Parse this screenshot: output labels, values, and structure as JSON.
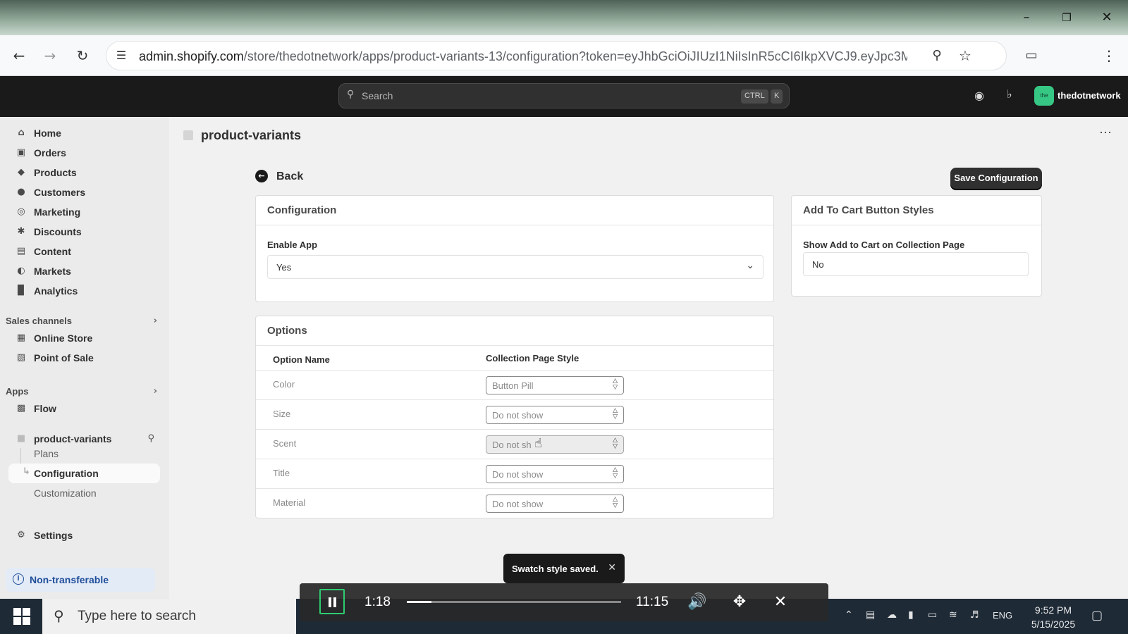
{
  "browser": {
    "url_host": "admin.shopify.com",
    "url_rest": "/store/thedotnetwork/apps/product-variants-13/configuration?token=eyJhbGciOiJIUzI1NiIsInR5cCI6IkpXVCJ9.eyJpc3MiOiJodH..."
  },
  "header": {
    "search_placeholder": "Search",
    "shortcut_key1": "CTRL",
    "shortcut_key2": "K",
    "store_badge": "the",
    "store_name": "thedotnetwork"
  },
  "sidebar": {
    "items": [
      {
        "label": "Home",
        "icon": "home-icon"
      },
      {
        "label": "Orders",
        "icon": "orders-icon"
      },
      {
        "label": "Products",
        "icon": "tag-icon"
      },
      {
        "label": "Customers",
        "icon": "person-icon"
      },
      {
        "label": "Marketing",
        "icon": "target-icon"
      },
      {
        "label": "Discounts",
        "icon": "discount-icon"
      },
      {
        "label": "Content",
        "icon": "content-icon"
      },
      {
        "label": "Markets",
        "icon": "globe-icon"
      },
      {
        "label": "Analytics",
        "icon": "chart-icon"
      }
    ],
    "sales_channels_label": "Sales channels",
    "channels": [
      {
        "label": "Online Store",
        "icon": "store-icon"
      },
      {
        "label": "Point of Sale",
        "icon": "pos-icon"
      }
    ],
    "apps_label": "Apps",
    "apps": [
      {
        "label": "Flow",
        "icon": "flow-icon"
      }
    ],
    "app_name": "product-variants",
    "app_subitems": [
      "Plans",
      "Configuration",
      "Customization"
    ],
    "settings_label": "Settings",
    "non_transferable": "Non-transferable"
  },
  "page": {
    "title": "product-variants",
    "back_label": "Back",
    "save_label": "Save Configuration"
  },
  "configuration": {
    "title": "Configuration",
    "enable_label": "Enable App",
    "enable_value": "Yes"
  },
  "add_to_cart": {
    "title": "Add To Cart Button Styles",
    "show_label": "Show Add to Cart on Collection Page",
    "show_value": "No"
  },
  "options": {
    "title": "Options",
    "col_name": "Option Name",
    "col_style": "Collection Page Style",
    "rows": [
      {
        "name": "Color",
        "style": "Button Pill"
      },
      {
        "name": "Size",
        "style": "Do not show"
      },
      {
        "name": "Scent",
        "style": "Do not sh"
      },
      {
        "name": "Title",
        "style": "Do not show"
      },
      {
        "name": "Material",
        "style": "Do not show"
      }
    ]
  },
  "toast": {
    "message": "Swatch style saved."
  },
  "taskbar": {
    "search_placeholder": "Type here to search",
    "language": "ENG",
    "time": "9:52 PM",
    "date": "5/15/2025"
  },
  "player": {
    "current_time": "1:18",
    "duration": "11:15",
    "progress_fraction": 0.116
  },
  "colors": {
    "save_button": "#303030",
    "store_badge": "#36c785",
    "player_accent": "#2ecc71"
  }
}
